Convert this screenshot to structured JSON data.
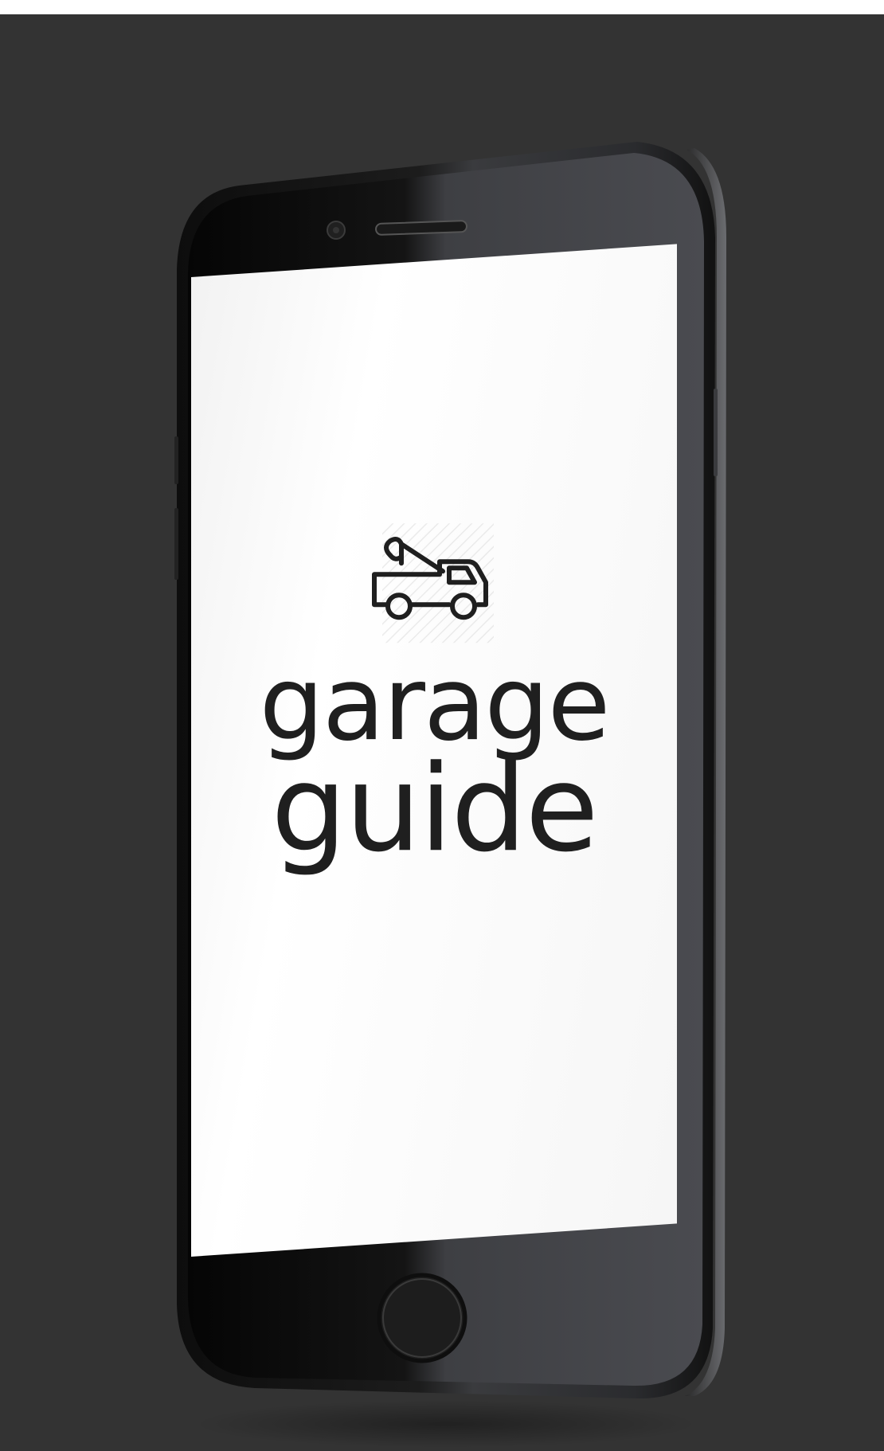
{
  "app": {
    "logo_icon": "tow-truck-icon",
    "brand_line1": "garage",
    "brand_line2": "guide"
  },
  "colors": {
    "background": "#333333",
    "phone_body": "#1a1a1a",
    "screen": "#ffffff",
    "text": "#1f1f1f"
  }
}
